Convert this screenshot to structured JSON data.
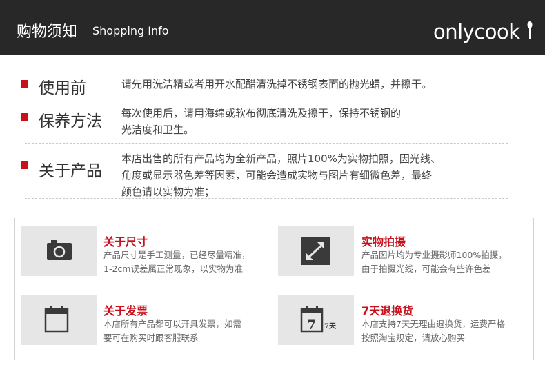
{
  "header": {
    "title": "购物须知",
    "subtitle": "Shopping Info",
    "logo_text": "onlycook"
  },
  "sections": [
    {
      "title": "使用前",
      "lines": [
        "请先用洗洁精或者用开水配醋清洗掉不锈钢表面的抛光蜡，并擦干。"
      ]
    },
    {
      "title": "保养方法",
      "lines": [
        "每次使用后，请用海绵或软布彻底清洗及擦干，保持不锈钢的",
        "光洁度和卫生。"
      ]
    },
    {
      "title": "关于产品",
      "lines": [
        "本店出售的所有产品均为全新产品，照片100%为实物拍照，因光线、",
        "角度或显示器色差等因素，可能会造成实物与图片有细微色差，最终",
        "颜色请以实物为准；"
      ]
    }
  ],
  "cards": [
    {
      "icon": "camera-icon",
      "title": "关于尺寸",
      "lines": [
        "产品尺寸是手工测量，已经尽量精准，",
        "1-2cm误差属正常现象，以实物为准"
      ]
    },
    {
      "icon": "expand-arrows-icon",
      "title": "实物拍摄",
      "lines": [
        "产品图片均为专业摄影师100%拍摄，",
        "由于拍摄光线，可能会有些许色差"
      ]
    },
    {
      "icon": "calendar-icon",
      "title": "关于发票",
      "lines": [
        "本店所有产品都可以开具发票，如需",
        "要可在购买时跟客服联系"
      ]
    },
    {
      "icon": "calendar-7-icon",
      "title": "7天退换货",
      "icon_text": "7",
      "icon_text_small": "7天",
      "lines": [
        "本店支持7天无理由退换货，运费严格",
        "按照淘宝规定，请放心购买"
      ]
    }
  ],
  "colors": {
    "header_bg": "#282828",
    "accent": "#c8101b",
    "icon_bg": "#e6e6e6",
    "icon_fg": "#3a3a3a"
  }
}
